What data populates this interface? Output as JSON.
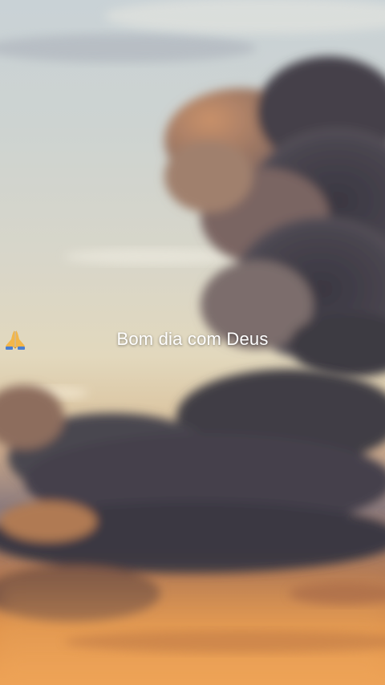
{
  "story": {
    "caption_text": "Bom dia com Deus",
    "caption_icon": "folded-hands-icon"
  },
  "colors": {
    "sky_top": "#c9d2d6",
    "cloud_dark": "#3f3c45",
    "sunset_orange": "#eda256",
    "text": "#ffffff"
  }
}
